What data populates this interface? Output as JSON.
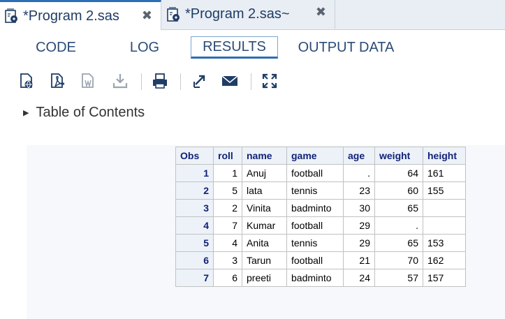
{
  "file_tabs": [
    {
      "label": "*Program 2.sas",
      "active": true,
      "close": "✖"
    },
    {
      "label": "*Program 2.sas~",
      "active": false,
      "close": "✖"
    }
  ],
  "view_tabs": {
    "code": "CODE",
    "log": "LOG",
    "results": "RESULTS",
    "output_data": "OUTPUT DATA",
    "selected": "RESULTS"
  },
  "toolbar": {
    "icons": [
      "download-html-icon",
      "download-pdf-icon",
      "download-rtf-icon",
      "download-icon",
      "print-icon",
      "open-new-window-icon",
      "email-icon",
      "maximize-icon"
    ]
  },
  "toc": {
    "label": "Table of Contents",
    "expanded": false
  },
  "colors": {
    "accent": "#2c6fb6",
    "header_text": "#112277",
    "header_bg": "#edf2f9"
  },
  "results_table": {
    "columns": [
      "Obs",
      "roll",
      "name",
      "game",
      "age",
      "weight",
      "height"
    ],
    "rows": [
      [
        "1",
        "1",
        "Anuj",
        "football",
        ".",
        "64",
        "161"
      ],
      [
        "2",
        "5",
        "lata",
        "tennis",
        "23",
        "60",
        "155"
      ],
      [
        "3",
        "2",
        "Vinita",
        "badminto",
        "30",
        "65",
        ""
      ],
      [
        "4",
        "7",
        "Kumar",
        "football",
        "29",
        ".",
        ""
      ],
      [
        "5",
        "4",
        "Anita",
        "tennis",
        "29",
        "65",
        "153"
      ],
      [
        "6",
        "3",
        "Tarun",
        "football",
        "21",
        "70",
        "162"
      ],
      [
        "7",
        "6",
        "preeti",
        "badminto",
        "24",
        "57",
        "157"
      ]
    ]
  }
}
